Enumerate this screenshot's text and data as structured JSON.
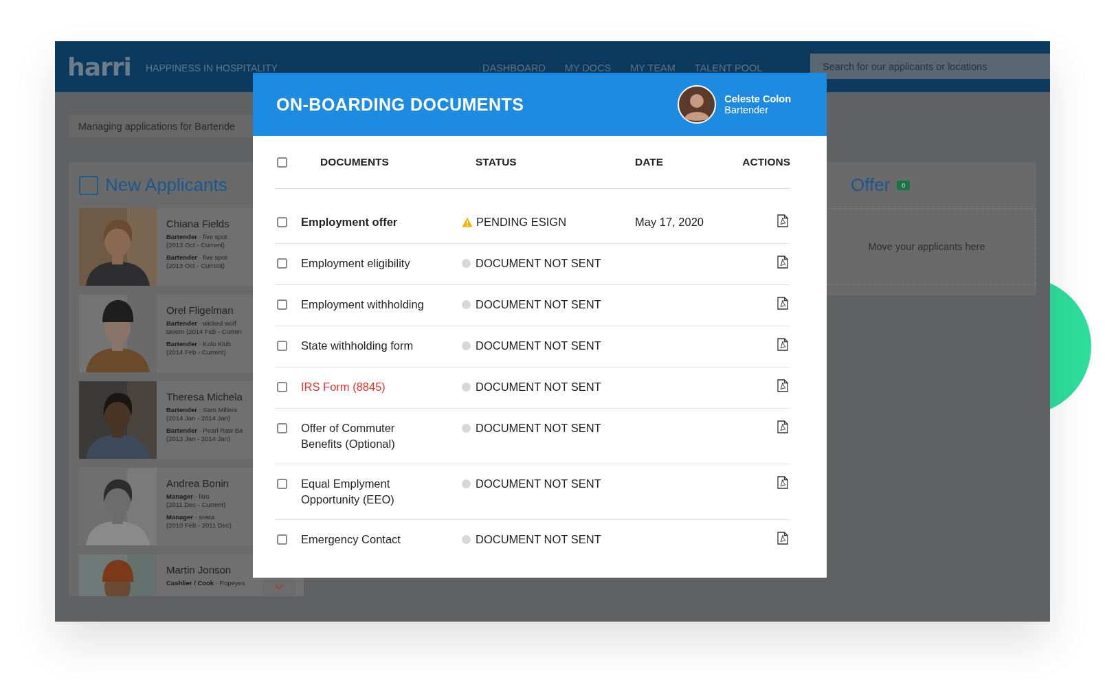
{
  "top_bar": {
    "logo": "harri",
    "tagline": "HAPPINESS IN HOSPITALITY",
    "nav": [
      "DASHBOARD",
      "MY DOCS",
      "MY TEAM",
      "TALENT POOL"
    ],
    "search": {
      "placeholder": "Search for our applicants or locations"
    }
  },
  "context_bar": "Managing applications for Bartende",
  "new_applicants": {
    "title": "New Applicants",
    "select_all": {
      "checked": false
    },
    "applicants": [
      {
        "name": "Chiana Fields",
        "jobs": [
          {
            "line1": "**Bartender** · five spot",
            "line2": "(2013 Oct - Current)"
          },
          {
            "line1": "**Bartender** · five spot",
            "line2": "(2013 Oct - Current)"
          }
        ]
      },
      {
        "name": "Orel Fligelman",
        "jobs": [
          {
            "line1": "**Bartender** · wicked wolf",
            "line2": "tavern (2014 Feb - Curren"
          },
          {
            "line1": "**Bartender** · Kolo Klub",
            "line2": "(2014 Feb - Current)"
          }
        ]
      },
      {
        "name": "Theresa Michela",
        "jobs": [
          {
            "line1": "**Bartender** · Sam Millers",
            "line2": "(2014 Jan - 2014 Jan)"
          },
          {
            "line1": "**Bartender** · Pearl Raw Ba",
            "line2": "(2013 Jan - 2014 Jan)"
          }
        ]
      },
      {
        "name": "Andrea Bonin",
        "jobs": [
          {
            "line1": "**Manager** · litro",
            "line2": "(2011 Dec - Current)"
          },
          {
            "line1": "**Manager** · sosta",
            "line2": "(2010 Feb - 2011 Dec)"
          }
        ]
      },
      {
        "name": "Martin Jonson",
        "jobs": [
          {
            "line1": "**Cashlier / Cook** · Popeyes"
          }
        ]
      }
    ]
  },
  "offer": {
    "title": "Offer",
    "count": "0",
    "drop_hint": "Move your applicants here"
  },
  "modal": {
    "title": "ON-BOARDING DOCUMENTS",
    "person": {
      "name": "Celeste Colon",
      "role": "Bartender"
    },
    "select_all": {
      "checked": false
    },
    "columns": [
      "DOCUMENTS",
      "STATUS",
      "DATE",
      "ACTIONS"
    ],
    "rows": [
      {
        "name": "Employment offer",
        "kind": "bold",
        "checked": false,
        "status": {
          "kind": "warning",
          "label": "PENDING ESIGN"
        },
        "date": "May 17, 2020"
      },
      {
        "name": "Employment eligibility",
        "kind": "plain",
        "checked": false,
        "status": {
          "kind": "idle",
          "label": "DOCUMENT NOT SENT"
        }
      },
      {
        "name": "Employment withholding",
        "kind": "plain",
        "checked": false,
        "status": {
          "kind": "idle",
          "label": "DOCUMENT NOT SENT"
        }
      },
      {
        "name": "State withholding form",
        "kind": "plain",
        "checked": false,
        "status": {
          "kind": "idle",
          "label": "DOCUMENT NOT SENT"
        }
      },
      {
        "name": "IRS Form (8845)",
        "kind": "error",
        "checked": false,
        "status": {
          "kind": "idle",
          "label": "DOCUMENT NOT SENT"
        }
      },
      {
        "name": "Offer of Commuter\nBenefits (Optional)",
        "kind": "plain",
        "checked": false,
        "status": {
          "kind": "idle",
          "label": "DOCUMENT NOT SENT"
        }
      },
      {
        "name": "Equal Emplyment\nOpportunity (EEO)",
        "kind": "plain",
        "checked": false,
        "status": {
          "kind": "idle",
          "label": "DOCUMENT NOT SENT"
        }
      },
      {
        "name": "Emergency Contact",
        "kind": "plain",
        "checked": false,
        "status": {
          "kind": "idle",
          "label": "DOCUMENT NOT SENT"
        }
      }
    ]
  }
}
